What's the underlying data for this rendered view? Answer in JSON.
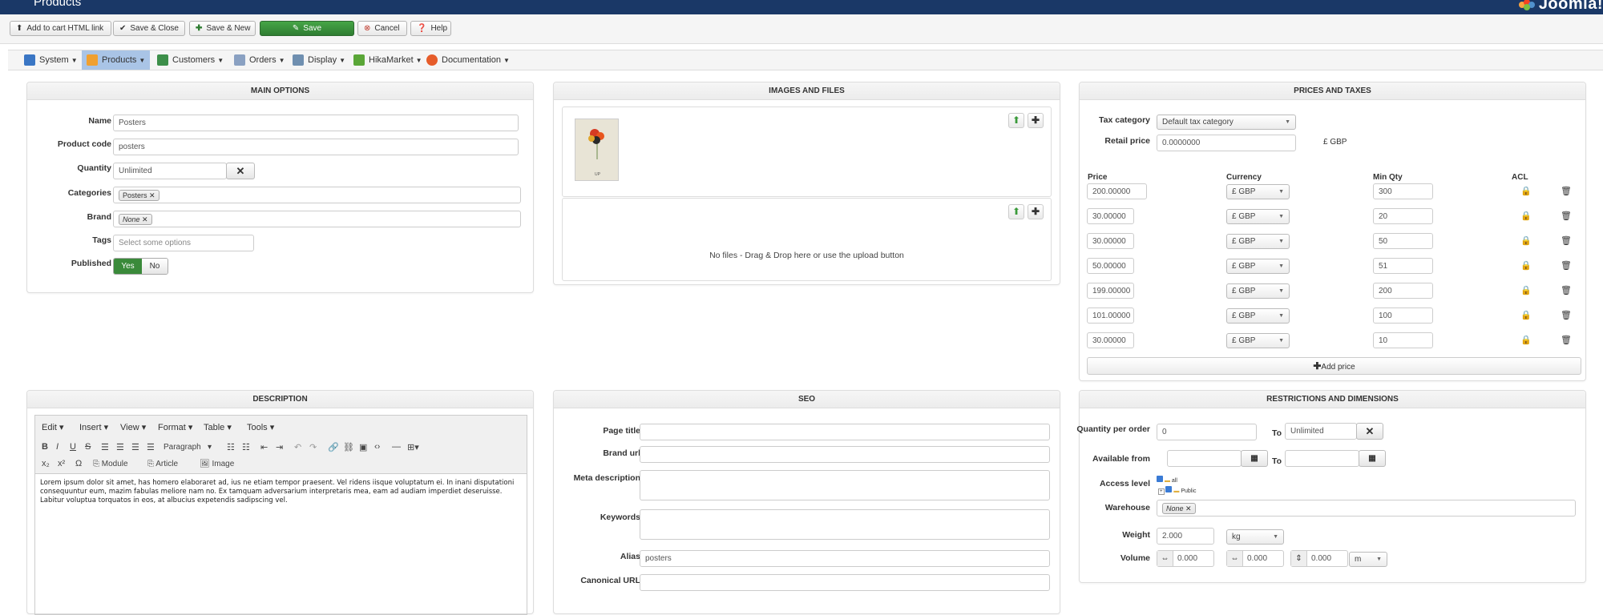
{
  "header": {
    "title": "Products",
    "logo": "Joomla!"
  },
  "toolbar": {
    "add_to_cart": "Add to cart HTML link",
    "save_close": "Save & Close",
    "save_new": "Save & New",
    "save": "Save",
    "cancel": "Cancel",
    "help": "Help"
  },
  "menu": [
    {
      "label": "System",
      "color": "#3a76c4"
    },
    {
      "label": "Products",
      "color": "#f0a030"
    },
    {
      "label": "Customers",
      "color": "#3d8f4a"
    },
    {
      "label": "Orders",
      "color": "#8aa1c2"
    },
    {
      "label": "Display",
      "color": "#6f8fb0"
    },
    {
      "label": "HikaMarket",
      "color": "#5aa637"
    },
    {
      "label": "Documentation",
      "color": "#e65c2a"
    }
  ],
  "main_options": {
    "title": "MAIN OPTIONS",
    "name_label": "Name",
    "name_value": "Posters",
    "code_label": "Product code",
    "code_value": "posters",
    "quantity_label": "Quantity",
    "quantity_value": "Unlimited",
    "categories_label": "Categories",
    "categories_tag": "Posters",
    "brand_label": "Brand",
    "brand_tag": "None",
    "tags_label": "Tags",
    "tags_placeholder": "Select some options",
    "published_label": "Published",
    "yes": "Yes",
    "no": "No"
  },
  "images": {
    "title": "IMAGES AND FILES",
    "no_files": "No files - Drag & Drop here or use the upload button"
  },
  "prices": {
    "title": "PRICES AND TAXES",
    "tax_label": "Tax category",
    "tax_value": "Default tax category",
    "retail_label": "Retail price",
    "retail_value": "0.0000000",
    "retail_unit": "£ GBP",
    "col_price": "Price",
    "col_currency": "Currency",
    "col_minqty": "Min Qty",
    "col_acl": "ACL",
    "rows": [
      {
        "price": "200.00000",
        "currency": "£ GBP",
        "qty": "300"
      },
      {
        "price": "30.00000",
        "currency": "£ GBP",
        "qty": "20"
      },
      {
        "price": "30.00000",
        "currency": "£ GBP",
        "qty": "50"
      },
      {
        "price": "50.00000",
        "currency": "£ GBP",
        "qty": "51"
      },
      {
        "price": "199.00000",
        "currency": "£ GBP",
        "qty": "200"
      },
      {
        "price": "101.00000",
        "currency": "£ GBP",
        "qty": "100"
      },
      {
        "price": "30.00000",
        "currency": "£ GBP",
        "qty": "10"
      }
    ],
    "add_price": "Add price"
  },
  "description": {
    "title": "DESCRIPTION",
    "menus": [
      "Edit",
      "Insert",
      "View",
      "Format",
      "Table",
      "Tools"
    ],
    "paragraph": "Paragraph",
    "module": "Module",
    "article": "Article",
    "image": "Image",
    "body": "Lorem ipsum dolor sit amet, has homero elaboraret ad, ius ne etiam tempor praesent. Vel ridens iisque voluptatum ei. In inani disputationi consequuntur eum, mazim fabulas meliore nam no. Ex tamquam adversarium interpretaris mea, eam ad audiam imperdiet deseruisse. Labitur voluptua torquatos in eos, at albucius expetendis sadipscing vel."
  },
  "seo": {
    "title": "SEO",
    "page_title": "Page title",
    "brand_url": "Brand url",
    "meta_desc": "Meta description",
    "keywords": "Keywords",
    "alias": "Alias",
    "alias_value": "posters",
    "canonical": "Canonical URL"
  },
  "restrictions": {
    "title": "RESTRICTIONS AND DIMENSIONS",
    "qty_label": "Quantity per order",
    "qty_from": "0",
    "to": "To",
    "qty_to": "Unlimited",
    "available_label": "Available from",
    "access_label": "Access level",
    "access_all": "all",
    "access_public": "Public",
    "warehouse_label": "Warehouse",
    "warehouse_tag": "None",
    "weight_label": "Weight",
    "weight_value": "2.000",
    "weight_unit": "kg",
    "volume_label": "Volume",
    "vol1": "0.000",
    "vol2": "0.000",
    "vol3": "0.000",
    "vol_unit": "m"
  }
}
